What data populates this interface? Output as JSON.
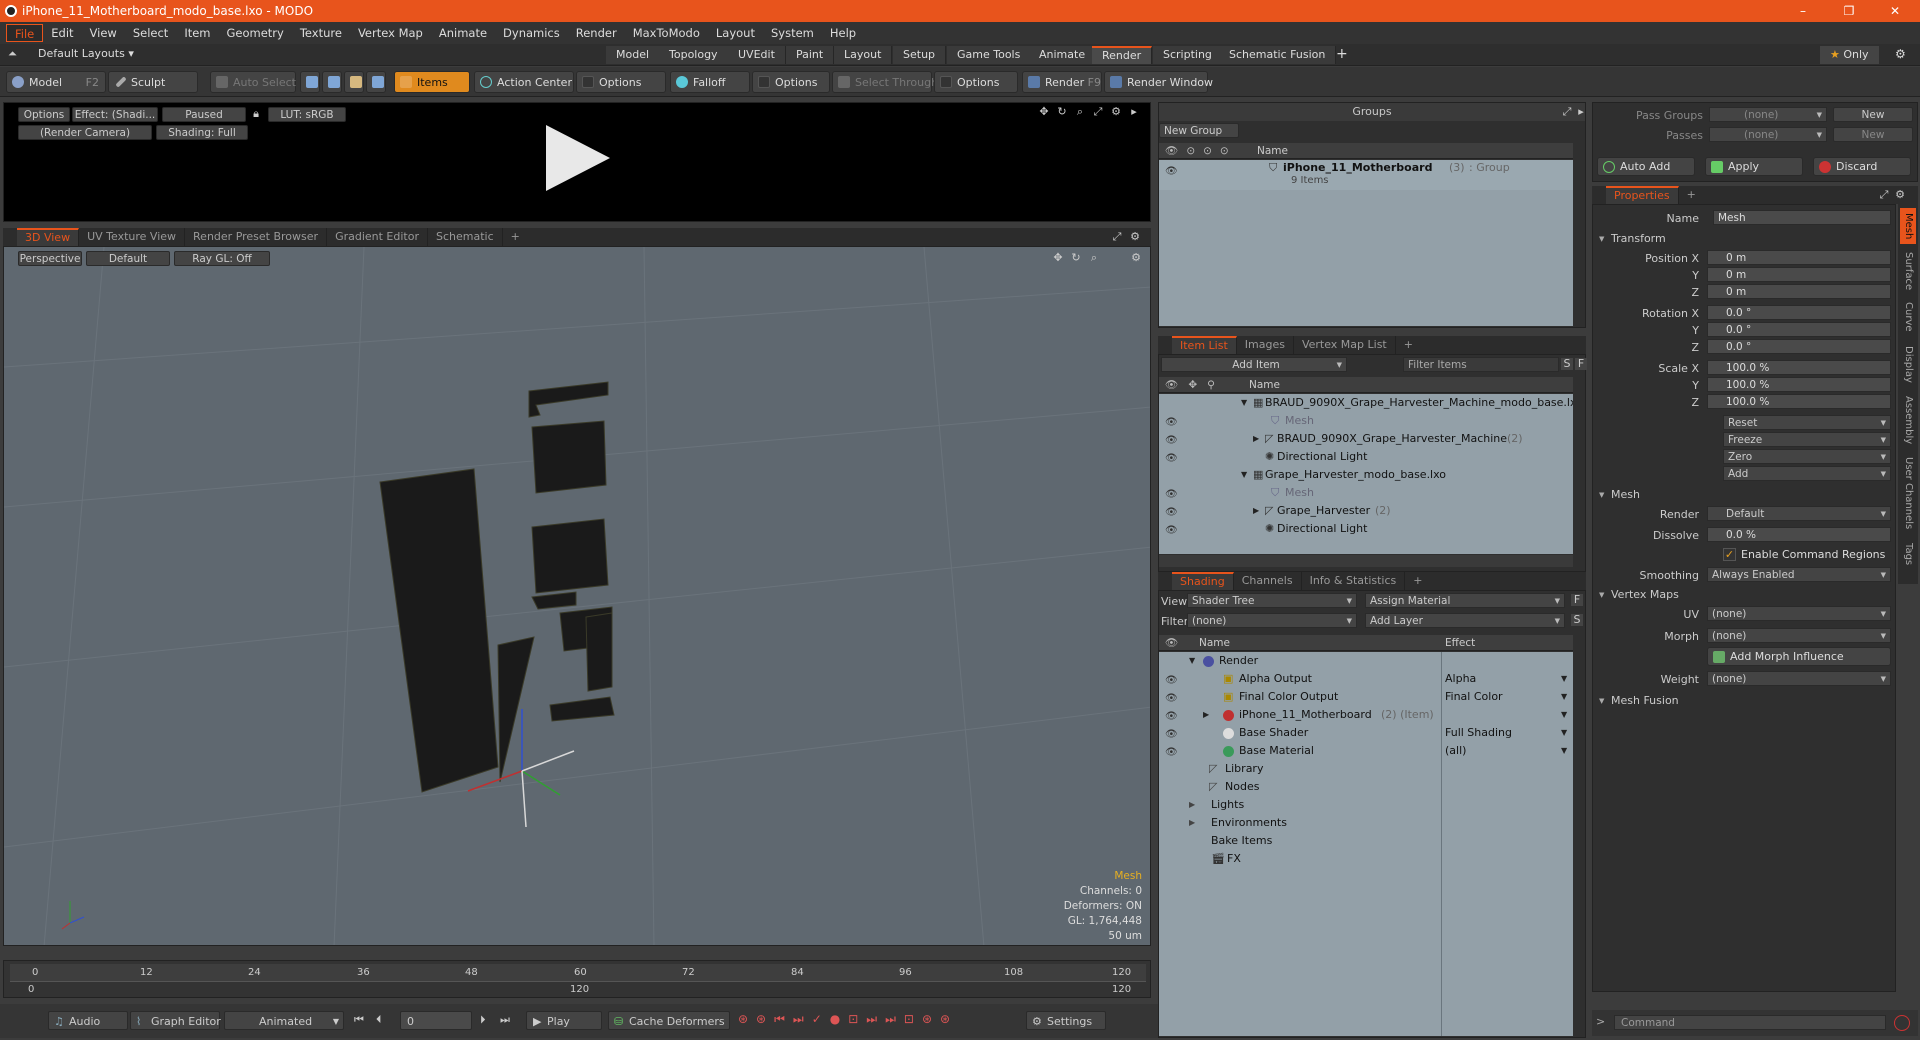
{
  "window": {
    "title": "iPhone_11_Motherboard_modo_base.lxo - MODO",
    "minimize": "–",
    "restore": "❐",
    "close": "✕"
  },
  "menu": [
    "File",
    "Edit",
    "View",
    "Select",
    "Item",
    "Geometry",
    "Texture",
    "Vertex Map",
    "Animate",
    "Dynamics",
    "Render",
    "MaxToModo",
    "Layout",
    "System",
    "Help"
  ],
  "layouts": {
    "default_layouts": "Default Layouts",
    "tabs": [
      "Model",
      "Topology",
      "UVEdit",
      "Paint",
      "Layout",
      "Setup",
      "Game Tools",
      "Animate",
      "Render",
      "Scripting",
      "Schematic Fusion"
    ],
    "add": "+",
    "only": "Only"
  },
  "toolbar": {
    "model": "Model",
    "model_key": "F2",
    "sculpt": "Sculpt",
    "auto_select": "Auto Select",
    "items": "Items",
    "action_center": "Action Center",
    "options1": "Options",
    "falloff": "Falloff",
    "options2": "Options",
    "select_through": "Select Through",
    "options3": "Options",
    "render": "Render",
    "render_key": "F9",
    "render_window": "Render Window"
  },
  "render_preview": {
    "options": "Options",
    "effect": "Effect: (Shadi...",
    "paused": "Paused",
    "lut": "LUT: sRGB",
    "camera": "(Render Camera)",
    "shading": "Shading: Full"
  },
  "viewport": {
    "tabs": [
      "3D View",
      "UV Texture View",
      "Render Preset Browser",
      "Gradient Editor",
      "Schematic"
    ],
    "add": "+",
    "perspective": "Perspective",
    "default": "Default",
    "raygl": "Ray GL: Off",
    "info": {
      "selected": "Mesh",
      "channels": "Channels: 0",
      "deformers": "Deformers: ON",
      "gl": "GL: 1,764,448",
      "unit": "50 um"
    }
  },
  "timeline": {
    "ticks": [
      "0",
      "12",
      "24",
      "36",
      "48",
      "60",
      "72",
      "84",
      "96",
      "108",
      "120"
    ],
    "start": "0",
    "end": "120",
    "mid": "120",
    "end2": "120"
  },
  "bottom": {
    "audio": "Audio",
    "graph_editor": "Graph Editor",
    "animated": "Animated",
    "frame": "0",
    "play": "Play",
    "cache_deformers": "Cache Deformers",
    "settings": "Settings"
  },
  "groups": {
    "title": "Groups",
    "new_group": "New Group",
    "col_name": "Name",
    "item_name": "iPhone_11_Motherboard",
    "item_count": "(3)",
    "item_type": ": Group",
    "item_sub": "9 Items"
  },
  "item_list": {
    "tabs": [
      "Item List",
      "Images",
      "Vertex Map List"
    ],
    "add": "+",
    "add_item": "Add Item",
    "filter": "Filter Items",
    "col_name": "Name",
    "rows": [
      {
        "label": "BRAUD_9090X_Grape_Harvester_Machine_modo_base.lxo",
        "count": ""
      },
      {
        "label": "Mesh",
        "count": ""
      },
      {
        "label": "BRAUD_9090X_Grape_Harvester_Machine",
        "count": "(2)"
      },
      {
        "label": "Directional Light",
        "count": ""
      },
      {
        "label": "Grape_Harvester_modo_base.lxo",
        "count": ""
      },
      {
        "label": "Mesh",
        "count": ""
      },
      {
        "label": "Grape_Harvester",
        "count": "(2)"
      },
      {
        "label": "Directional Light",
        "count": ""
      }
    ]
  },
  "shading": {
    "tabs": [
      "Shading",
      "Channels",
      "Info & Statistics"
    ],
    "add": "+",
    "view_label": "View",
    "view_value": "Shader Tree",
    "assign": "Assign Material",
    "filter_label": "Filter",
    "filter_value": "(none)",
    "add_layer": "Add Layer",
    "col_name": "Name",
    "col_effect": "Effect",
    "rows": [
      {
        "label": "Render",
        "effect": ""
      },
      {
        "label": "Alpha Output",
        "effect": "Alpha"
      },
      {
        "label": "Final Color Output",
        "effect": "Final Color"
      },
      {
        "label": "iPhone_11_Motherboard",
        "extra": "(2) (Item)",
        "effect": ""
      },
      {
        "label": "Base Shader",
        "effect": "Full Shading"
      },
      {
        "label": "Base Material",
        "effect": "(all)"
      },
      {
        "label": "Library",
        "effect": ""
      },
      {
        "label": "Nodes",
        "effect": ""
      },
      {
        "label": "Lights",
        "effect": ""
      },
      {
        "label": "Environments",
        "effect": ""
      },
      {
        "label": "Bake Items",
        "effect": ""
      },
      {
        "label": "FX",
        "effect": ""
      }
    ]
  },
  "passes": {
    "pass_groups": "Pass Groups",
    "passes": "Passes",
    "none": "(none)",
    "new": "New",
    "auto_add": "Auto Add",
    "apply": "Apply",
    "discard": "Discard"
  },
  "properties": {
    "tab": "Properties",
    "add": "+",
    "name_label": "Name",
    "name_value": "Mesh",
    "transform": "Transform",
    "pos_label": "Position X",
    "y": "Y",
    "z": "Z",
    "pos": [
      "0 m",
      "0 m",
      "0 m"
    ],
    "rot_label": "Rotation X",
    "rot": [
      "0.0 °",
      "0.0 °",
      "0.0 °"
    ],
    "scale_label": "Scale X",
    "scale": [
      "100.0 %",
      "100.0 %",
      "100.0 %"
    ],
    "reset": "Reset",
    "freeze": "Freeze",
    "zero": "Zero",
    "add_btn": "Add",
    "mesh": "Mesh",
    "render_label": "Render",
    "render_value": "Default",
    "dissolve_label": "Dissolve",
    "dissolve_value": "0.0 %",
    "enable_regions": "Enable Command Regions",
    "smoothing_label": "Smoothing",
    "smoothing_value": "Always Enabled",
    "vertex_maps": "Vertex Maps",
    "uv_label": "UV",
    "uv_value": "(none)",
    "morph_label": "Morph",
    "morph_value": "(none)",
    "add_morph": "Add Morph Influence",
    "weight_label": "Weight",
    "weight_value": "(none)",
    "mesh_fusion": "Mesh Fusion",
    "side_tabs": [
      "Mesh",
      "Surface",
      "Curve",
      "Display",
      "Assembly",
      "User Channels",
      "Tags"
    ],
    "command": "Command"
  },
  "colors": {
    "accent": "#e8541c",
    "items_btn": "#e08a1e"
  }
}
